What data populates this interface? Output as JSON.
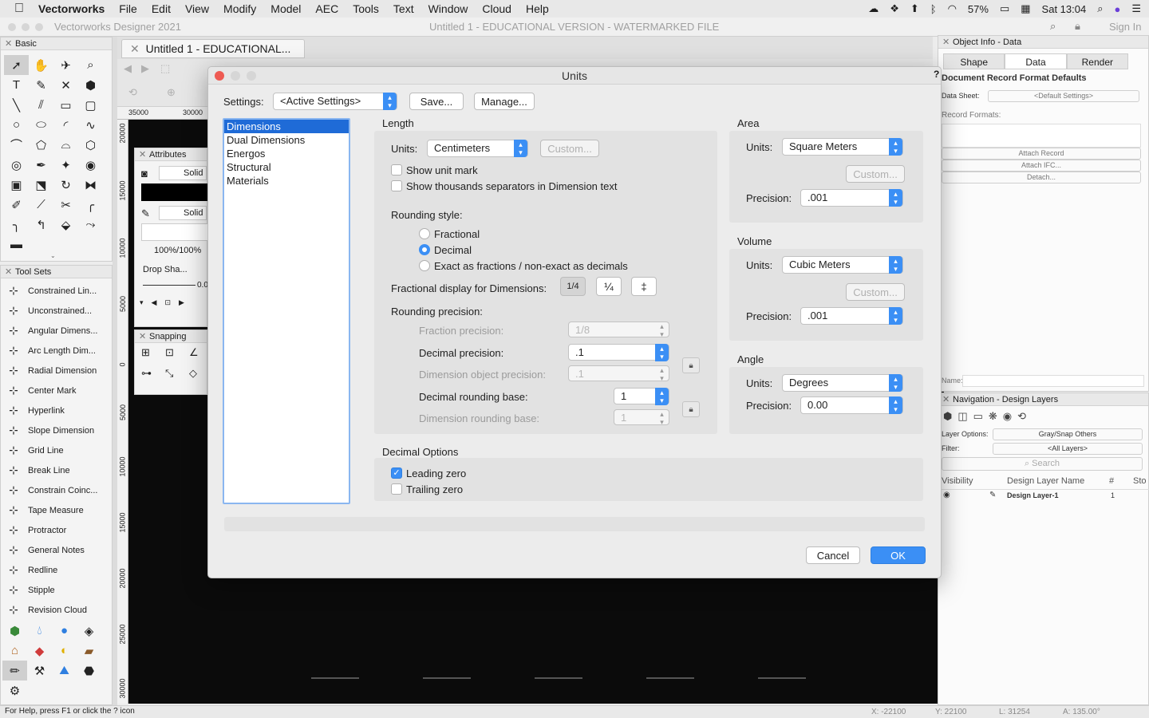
{
  "menubar": {
    "app": "Vectorworks",
    "items": [
      "File",
      "Edit",
      "View",
      "Modify",
      "Model",
      "AEC",
      "Tools",
      "Text",
      "Window",
      "Cloud",
      "Help"
    ],
    "battery": "57%",
    "clock": "Sat 13:04"
  },
  "window": {
    "app_title": "Vectorworks Designer 2021",
    "doc_title": "Untitled 1 - EDUCATIONAL VERSION - WATERMARKED FILE",
    "sign_in": "Sign In",
    "doc_tab": "Untitled 1 - EDUCATIONAL..."
  },
  "basic_palette": {
    "title": "Basic"
  },
  "toolsets": {
    "title": "Tool Sets",
    "items": [
      {
        "label": "Constrained Lin...",
        "icon": "constrained-linear-dim-icon"
      },
      {
        "label": "Unconstrained...",
        "icon": "unconstrained-dim-icon"
      },
      {
        "label": "Angular Dimens...",
        "icon": "angular-dim-icon"
      },
      {
        "label": "Arc Length Dim...",
        "icon": "arc-length-dim-icon"
      },
      {
        "label": "Radial Dimension",
        "icon": "radial-dim-icon"
      },
      {
        "label": "Center Mark",
        "icon": "center-mark-icon"
      },
      {
        "label": "Hyperlink",
        "icon": "hyperlink-icon"
      },
      {
        "label": "Slope Dimension",
        "icon": "slope-dim-icon"
      },
      {
        "label": "Grid Line",
        "icon": "grid-line-icon"
      },
      {
        "label": "Break Line",
        "icon": "break-line-icon"
      },
      {
        "label": "Constrain Coinc...",
        "icon": "constrain-coincident-icon"
      },
      {
        "label": "Tape Measure",
        "icon": "tape-measure-icon"
      },
      {
        "label": "Protractor",
        "icon": "protractor-icon"
      },
      {
        "label": "General Notes",
        "icon": "general-notes-icon"
      },
      {
        "label": "Redline",
        "icon": "redline-icon"
      },
      {
        "label": "Stipple",
        "icon": "stipple-icon"
      },
      {
        "label": "Revision Cloud",
        "icon": "revision-cloud-icon"
      }
    ]
  },
  "attributes": {
    "title": "Attributes",
    "fill": "Solid",
    "pen": "Solid",
    "opacity": "100%/100%",
    "drop_shadow": "Drop Sha...",
    "line_weight": "0.0"
  },
  "snapping": {
    "title": "Snapping"
  },
  "ruler": {
    "top": [
      "35000",
      "30000"
    ],
    "left": [
      "20000",
      "15000",
      "10000",
      "5000",
      "0",
      "5000",
      "10000",
      "15000",
      "20000",
      "25000",
      "30000"
    ]
  },
  "status": {
    "help": "For Help, press F1 or click the ? icon",
    "x": "X: -22100",
    "y": "Y: 22100",
    "l": "L: 31254",
    "a": "A: 135.00°"
  },
  "dialog": {
    "title": "Units",
    "settings_label": "Settings:",
    "settings_value": "<Active Settings>",
    "save": "Save...",
    "manage": "Manage...",
    "categories": [
      "Dimensions",
      "Dual Dimensions",
      "Energos",
      "Structural",
      "Materials"
    ],
    "length": {
      "title": "Length",
      "units_label": "Units:",
      "units_value": "Centimeters",
      "custom": "Custom...",
      "show_unit_mark": "Show unit mark",
      "show_thousands": "Show thousands separators in Dimension text",
      "rounding_style": "Rounding style:",
      "fractional": "Fractional",
      "decimal": "Decimal",
      "exact": "Exact as fractions / non-exact as decimals",
      "frac_display": "Fractional display for Dimensions:",
      "frac_icons": [
        "1/4",
        "¼",
        "‡"
      ],
      "rounding_precision": "Rounding precision:",
      "fraction_precision": "Fraction precision:",
      "fraction_precision_value": "1/8",
      "decimal_precision": "Decimal precision:",
      "decimal_precision_value": ".1",
      "dim_obj_precision": "Dimension object precision:",
      "dim_obj_precision_value": ".1",
      "decimal_rounding_base": "Decimal rounding base:",
      "decimal_rounding_base_value": "1",
      "dim_rounding_base": "Dimension rounding base:",
      "dim_rounding_base_value": "1"
    },
    "area": {
      "title": "Area",
      "units_label": "Units:",
      "units_value": "Square Meters",
      "custom": "Custom...",
      "precision_label": "Precision:",
      "precision_value": ".001"
    },
    "volume": {
      "title": "Volume",
      "units_label": "Units:",
      "units_value": "Cubic Meters",
      "custom": "Custom...",
      "precision_label": "Precision:",
      "precision_value": ".001"
    },
    "angle": {
      "title": "Angle",
      "units_label": "Units:",
      "units_value": "Degrees",
      "precision_label": "Precision:",
      "precision_value": "0.00"
    },
    "decimal_options": {
      "title": "Decimal Options",
      "leading_zero": "Leading zero",
      "trailing_zero": "Trailing zero"
    },
    "cancel": "Cancel",
    "ok": "OK"
  },
  "object_info": {
    "title": "Object Info - Data",
    "tabs": [
      "Shape",
      "Data",
      "Render"
    ],
    "heading": "Document Record Format Defaults",
    "data_sheet_label": "Data Sheet:",
    "data_sheet_value": "<Default Settings>",
    "record_formats": "Record Formats:",
    "attach_record": "Attach Record",
    "attach_ifc": "Attach IFC...",
    "detach": "Detach...",
    "name_label": "Name:"
  },
  "navigation": {
    "title": "Navigation - Design Layers",
    "layer_options_label": "Layer Options:",
    "layer_options_value": "Gray/Snap Others",
    "filter_label": "Filter:",
    "filter_value": "<All Layers>",
    "search": "Search",
    "cols": [
      "Visibility",
      "Design Layer Name",
      "#",
      "Sto"
    ],
    "row": {
      "name": "Design Layer-1",
      "num": "1"
    }
  }
}
